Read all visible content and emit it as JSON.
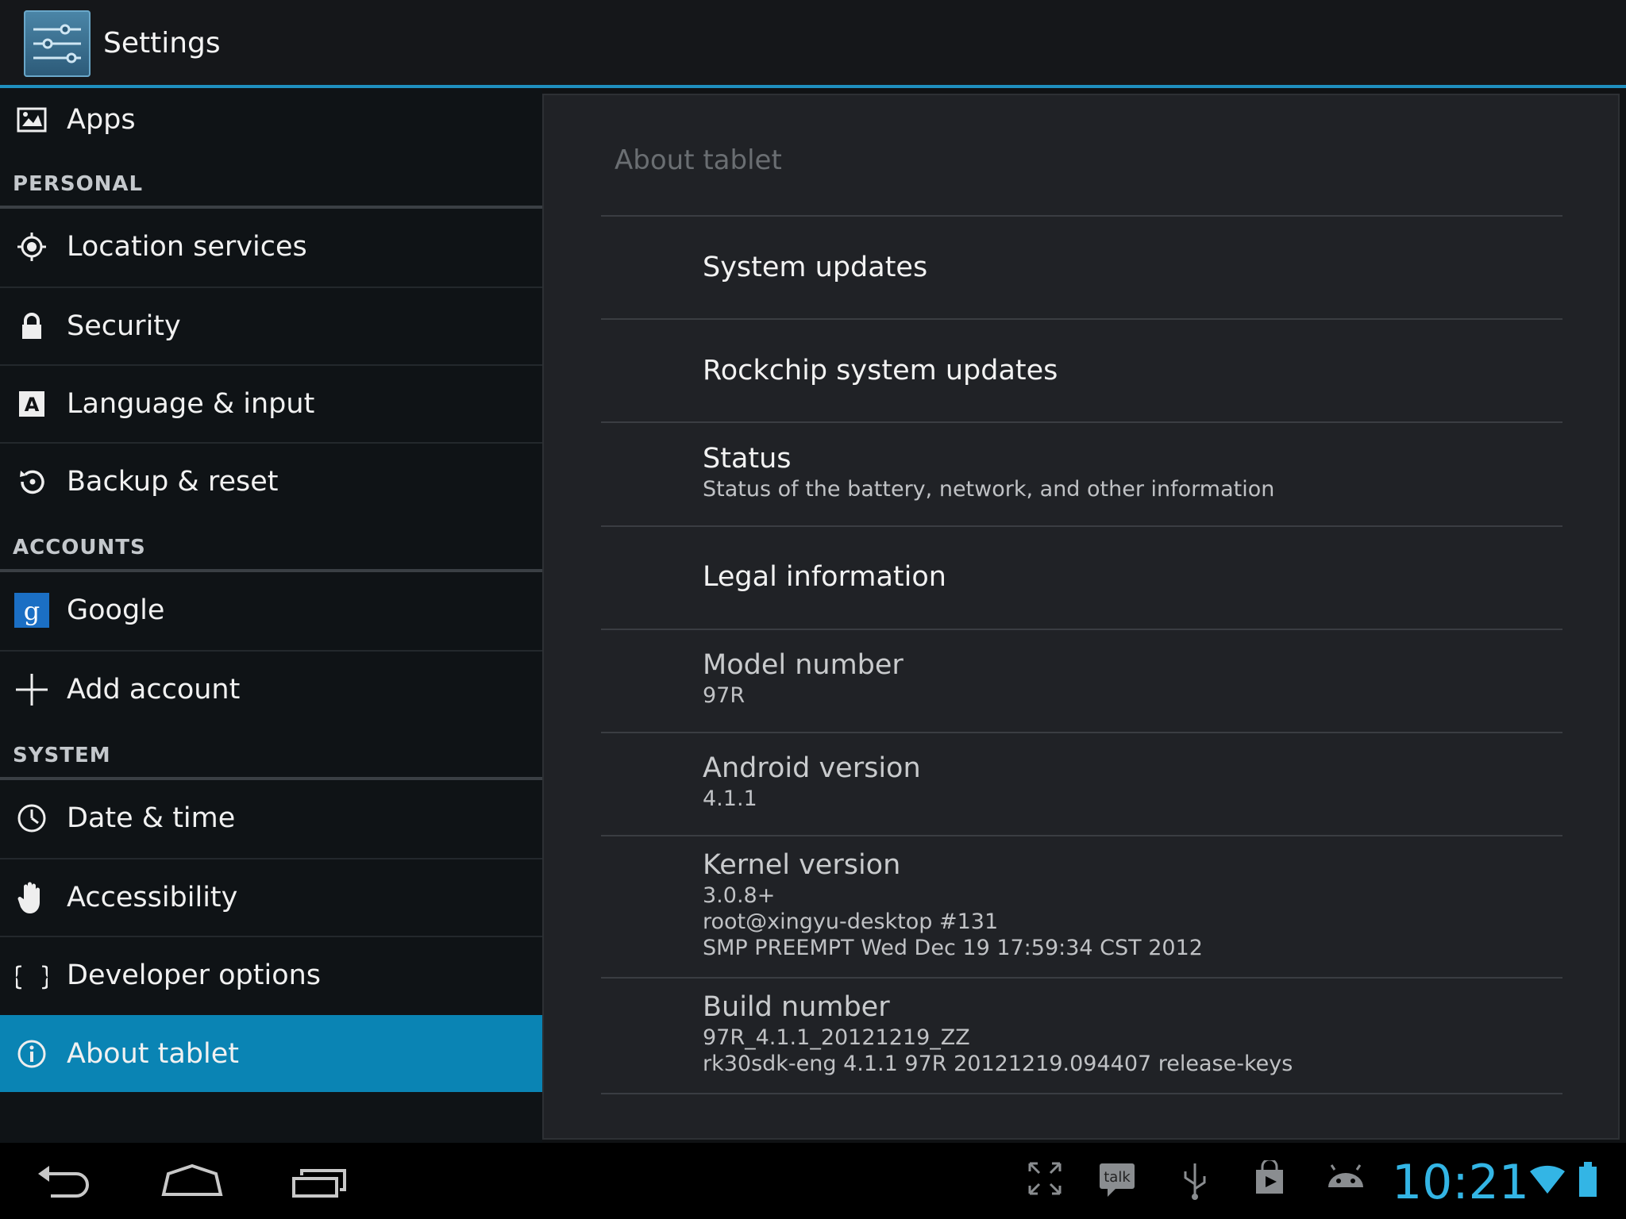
{
  "app": {
    "title": "Settings"
  },
  "sidebar": {
    "items": [
      {
        "label": "Apps"
      },
      {
        "header": "PERSONAL"
      },
      {
        "label": "Location services"
      },
      {
        "label": "Security"
      },
      {
        "label": "Language & input"
      },
      {
        "label": "Backup & reset"
      },
      {
        "header": "ACCOUNTS"
      },
      {
        "label": "Google"
      },
      {
        "label": "Add account"
      },
      {
        "header": "SYSTEM"
      },
      {
        "label": "Date & time"
      },
      {
        "label": "Accessibility"
      },
      {
        "label": "Developer options"
      },
      {
        "label": "About tablet",
        "selected": true
      }
    ]
  },
  "detail": {
    "title": "About tablet",
    "rows": [
      {
        "title": "System updates"
      },
      {
        "title": "Rockchip system updates"
      },
      {
        "title": "Status",
        "summary": "Status of the battery, network, and other information"
      },
      {
        "title": "Legal information"
      },
      {
        "title": "Model number",
        "summary": "97R"
      },
      {
        "title": "Android version",
        "summary": "4.1.1"
      },
      {
        "title": "Kernel version",
        "summary_lines": [
          "3.0.8+",
          "root@xingyu-desktop #131",
          "SMP PREEMPT Wed Dec 19 17:59:34 CST 2012"
        ]
      },
      {
        "title": "Build number",
        "summary_lines": [
          "97R_4.1.1_20121219_ZZ",
          "rk30sdk-eng 4.1.1 97R 20121219.094407 release-keys"
        ]
      }
    ]
  },
  "statusbar": {
    "time": "10:21",
    "talk_label": "talk",
    "accent": "#33b5e5"
  },
  "colors": {
    "selected": "#0a84b4",
    "accent_line": "#1f8fbf"
  }
}
